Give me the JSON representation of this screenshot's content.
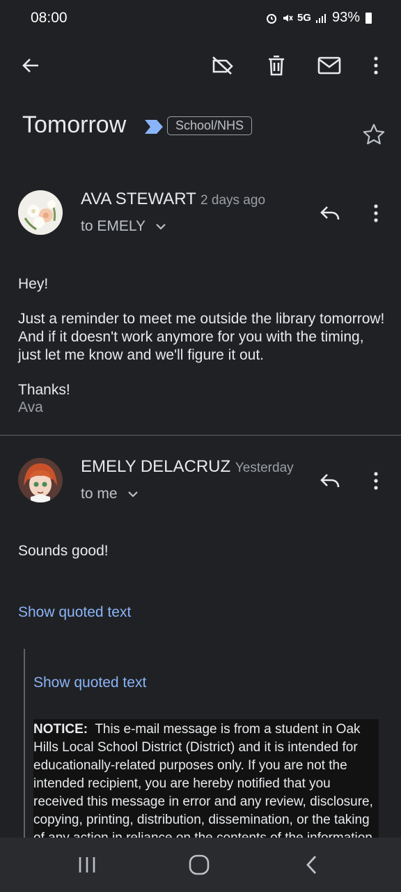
{
  "status_bar": {
    "time": "08:00",
    "network": "5G",
    "battery": "93%"
  },
  "toolbar": {
    "back_icon": "arrow-left-icon",
    "icons": [
      "label-off-icon",
      "trash-icon",
      "mail-icon",
      "more-vert-icon"
    ]
  },
  "thread": {
    "subject": "Tomorrow",
    "label": "School/NHS"
  },
  "messages": [
    {
      "sender": "AVA STEWART",
      "time": "2 days ago",
      "recipients": "to EMELY",
      "body": {
        "greeting": "Hey!",
        "paragraph": "Just a reminder to meet me outside the library tomorrow! And if it doesn't work anymore for you with the timing, just let me know and we'll figure it out.",
        "closing": "Thanks!",
        "signature": "Ava"
      }
    },
    {
      "sender": "EMELY DELACRUZ",
      "time": "Yesterday",
      "recipients": "to me",
      "body": {
        "text": "Sounds good!",
        "show_quoted_outer": "Show quoted text",
        "show_quoted_inner": "Show quoted text",
        "notice_label": "NOTICE:",
        "notice_text": "This e-mail message is from a student in Oak Hills Local School District (District) and it is intended for educationally-related purposes only.  If you are not the intended recipient, you are hereby notified that you received this message in error and any review, disclosure, copying, printing, distribution, dissemination, or the taking of any action in reliance on the contents of the information"
      }
    }
  ],
  "colors": {
    "background": "#202124",
    "link": "#8ab4f8",
    "important": "#8ab4f8"
  }
}
